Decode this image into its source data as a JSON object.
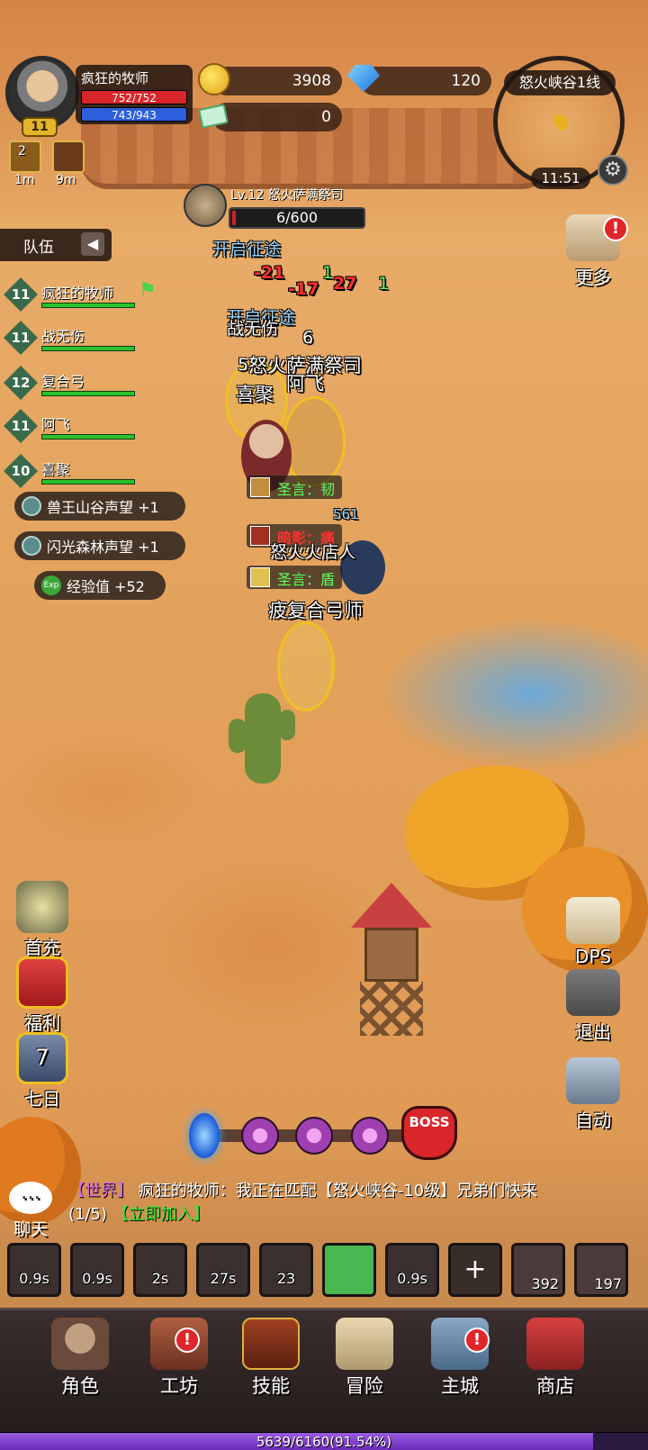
{
  "player": {
    "name": "疯狂的牧师",
    "level": "11",
    "hp": "752/752",
    "mp": "743/943"
  },
  "buffs": [
    {
      "count": "2",
      "time": "1m"
    },
    {
      "count": "",
      "time": "9m"
    }
  ],
  "currency": {
    "gold": "3908",
    "gems": "120",
    "tickets": "0"
  },
  "minimap": {
    "zone": "怒火峡谷1线",
    "time": "11:51"
  },
  "boss": {
    "level_name": "Lv.12 怒火萨满祭司",
    "hp": "6/600"
  },
  "team": {
    "title": "队伍",
    "members": [
      {
        "level": "11",
        "name": "疯狂的牧师"
      },
      {
        "level": "11",
        "name": "战无伤"
      },
      {
        "level": "12",
        "name": "复合弓"
      },
      {
        "level": "11",
        "name": "阿飞"
      },
      {
        "level": "10",
        "name": "喜聚"
      }
    ]
  },
  "rewards": [
    {
      "text": "兽王山谷声望 +1"
    },
    {
      "text": "闪光森林声望 +1"
    },
    {
      "text": "经验值 +52"
    }
  ],
  "combat": {
    "open_path_1": "开启征途",
    "open_path_2": "开启征途",
    "dmg_1": "-21",
    "dmg_2": "-17",
    "dmg_3": "27",
    "heal_1": "1",
    "heal_2": "1",
    "boss_label": "怒火萨满祭司",
    "ally_1": "阿飞",
    "ally_2": "喜聚",
    "ally_3": "战无伤",
    "num_6": "6",
    "num_5": "5",
    "skill_1": "圣言：韧",
    "skill_2": "暗影：痛",
    "skill_3": "圣言：盾",
    "enemy_1": "怒火火店人",
    "enemy_2": "疲复合弓师",
    "num_561": "561"
  },
  "right_buttons": [
    "更多",
    "DPS",
    "退出",
    "自动"
  ],
  "left_buttons": [
    "首充",
    "福利",
    "七日"
  ],
  "seven_day_num": "7",
  "wave": {
    "boss": "BOSS"
  },
  "chat": {
    "button": "聊天",
    "channel": "【世界】",
    "message": "疯狂的牧师：我正在匹配【怒火峡谷-10级】兄弟们快来(1/5)",
    "join": "【立即加入】"
  },
  "skills": [
    {
      "cd": "0.9s"
    },
    {
      "cd": "0.9s"
    },
    {
      "cd": "2s"
    },
    {
      "cd": "27s"
    },
    {
      "cd": "23"
    },
    {
      "cd": ""
    },
    {
      "cd": "0.9s"
    }
  ],
  "items": [
    {
      "count": "392"
    },
    {
      "count": "197"
    }
  ],
  "nav": [
    "角色",
    "工坊",
    "技能",
    "冒险",
    "主城",
    "商店"
  ],
  "xp": {
    "text": "5639/6160(91.54%)",
    "fraction": 0.9154
  },
  "colors": {
    "hp": "#d8262b",
    "mp": "#2d5fdc",
    "xp": "#8a4ad0",
    "chat_channel": "#d86ae0",
    "chat_join": "#3ae83a"
  }
}
